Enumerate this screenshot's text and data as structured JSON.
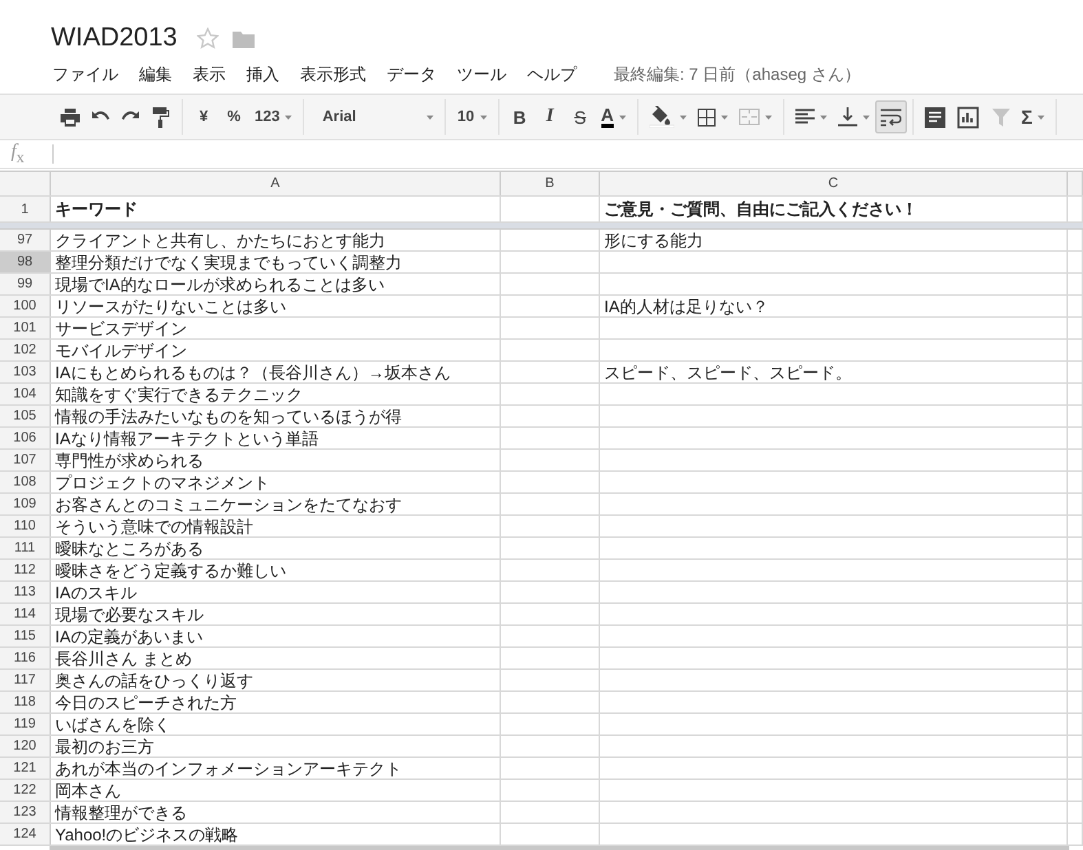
{
  "document": {
    "title": "WIAD2013",
    "starred": false
  },
  "menu": [
    "ファイル",
    "編集",
    "表示",
    "挿入",
    "表示形式",
    "データ",
    "ツール",
    "ヘルプ"
  ],
  "last_edit": "最終編集: 7 日前（ahaseg さん）",
  "toolbar": {
    "number_format": [
      "¥",
      "%",
      "123"
    ],
    "font": "Arial",
    "font_size": "10",
    "text_style": [
      "B",
      "I",
      "S",
      "A"
    ],
    "sum": "Σ",
    "merge_disabled": true,
    "wrap_selected": true,
    "filter_disabled": true
  },
  "formula_label": "*f*$_{x}$",
  "columns": [
    "A",
    "B",
    "C"
  ],
  "header_row": {
    "num": "1",
    "a": "キーワード",
    "c": "ご意見・ご質問、自由にご記入ください！"
  },
  "rows": [
    {
      "num": "97",
      "a": "クライアントと共有し、かたちにおとす能力",
      "c": "形にする能力",
      "selected": false
    },
    {
      "num": "98",
      "a": "整理分類だけでなく実現までもっていく調整力",
      "selected": true
    },
    {
      "num": "99",
      "a": "現場でIA的なロールが求められることは多い",
      "selected": false
    },
    {
      "num": "100",
      "a": "リソースがたりないことは多い",
      "c": "IA的人材は足りない？",
      "selected": false
    },
    {
      "num": "101",
      "a": "サービスデザイン",
      "selected": false
    },
    {
      "num": "102",
      "a": "モバイルデザイン",
      "selected": false
    },
    {
      "num": "103",
      "a": "IAにもとめられるものは？（長谷川さん）→坂本さん",
      "c": "スピード、スピード、スピード。",
      "selected": false
    },
    {
      "num": "104",
      "a": "知識をすぐ実行できるテクニック",
      "selected": false
    },
    {
      "num": "105",
      "a": "情報の手法みたいなものを知っているほうが得",
      "selected": false
    },
    {
      "num": "106",
      "a": "IAなり情報アーキテクトという単語",
      "selected": false
    },
    {
      "num": "107",
      "a": "専門性が求められる",
      "selected": false
    },
    {
      "num": "108",
      "a": "プロジェクトのマネジメント",
      "selected": false
    },
    {
      "num": "109",
      "a": "お客さんとのコミュニケーションをたてなおす",
      "selected": false
    },
    {
      "num": "110",
      "a": "そういう意味での情報設計",
      "selected": false
    },
    {
      "num": "111",
      "a": "曖昧なところがある",
      "selected": false
    },
    {
      "num": "112",
      "a": "曖昧さをどう定義するか難しい",
      "selected": false
    },
    {
      "num": "113",
      "a": "IAのスキル",
      "selected": false
    },
    {
      "num": "114",
      "a": "現場で必要なスキル",
      "selected": false
    },
    {
      "num": "115",
      "a": "IAの定義があいまい",
      "selected": false
    },
    {
      "num": "116",
      "a": "長谷川さん まとめ",
      "selected": false
    },
    {
      "num": "117",
      "a": "奥さんの話をひっくり返す",
      "selected": false
    },
    {
      "num": "118",
      "a": "今日のスピーチされた方",
      "selected": false
    },
    {
      "num": "119",
      "a": "いばさんを除く",
      "selected": false
    },
    {
      "num": "120",
      "a": "最初のお三方",
      "selected": false
    },
    {
      "num": "121",
      "a": "あれが本当のインフォメーションアーキテクト",
      "selected": false
    },
    {
      "num": "122",
      "a": "岡本さん",
      "selected": false
    },
    {
      "num": "123",
      "a": "情報整理ができる",
      "selected": false
    },
    {
      "num": "124",
      "a": "Yahoo!のビジネスの戦略",
      "selected": false
    }
  ]
}
